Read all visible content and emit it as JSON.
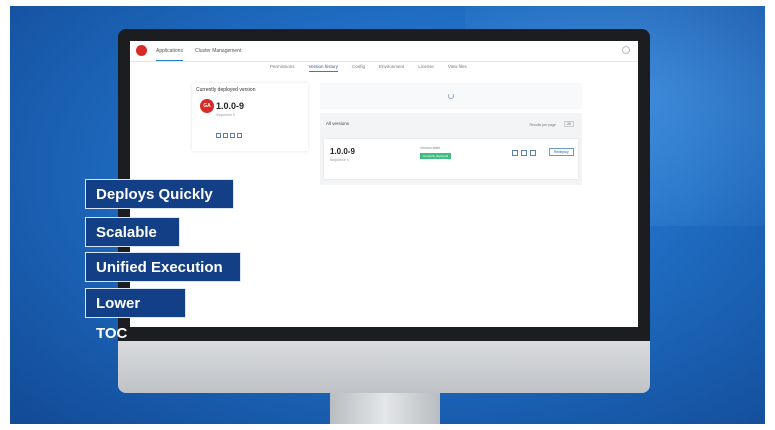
{
  "app": {
    "nav": [
      "Applications",
      "Cluster Management"
    ]
  },
  "tabs": [
    "Permissions",
    "Version history",
    "Config",
    "Environment",
    "License",
    "View files"
  ],
  "deployed": {
    "title": "Currently deployed version",
    "logo": "GA",
    "version": "1.0.0-9",
    "sub": "Sequence 5"
  },
  "results": {
    "title": "All versions",
    "rows_label": "Results per page",
    "rows_value": "20",
    "row": {
      "version": "1.0.0-9",
      "sub": "Sequence 5",
      "state_label": "Version state",
      "state": "Currently deployed",
      "button": "Redeploy"
    }
  },
  "overlay": {
    "labels": [
      "Deploys Quickly",
      "Scalable",
      "Unified Execution",
      "Lower TOC"
    ]
  },
  "colors": {
    "background": "#1f6cc2",
    "label_bg": "#123f86",
    "accent": "#d92a2a",
    "status_green": "#3fbf7f"
  }
}
